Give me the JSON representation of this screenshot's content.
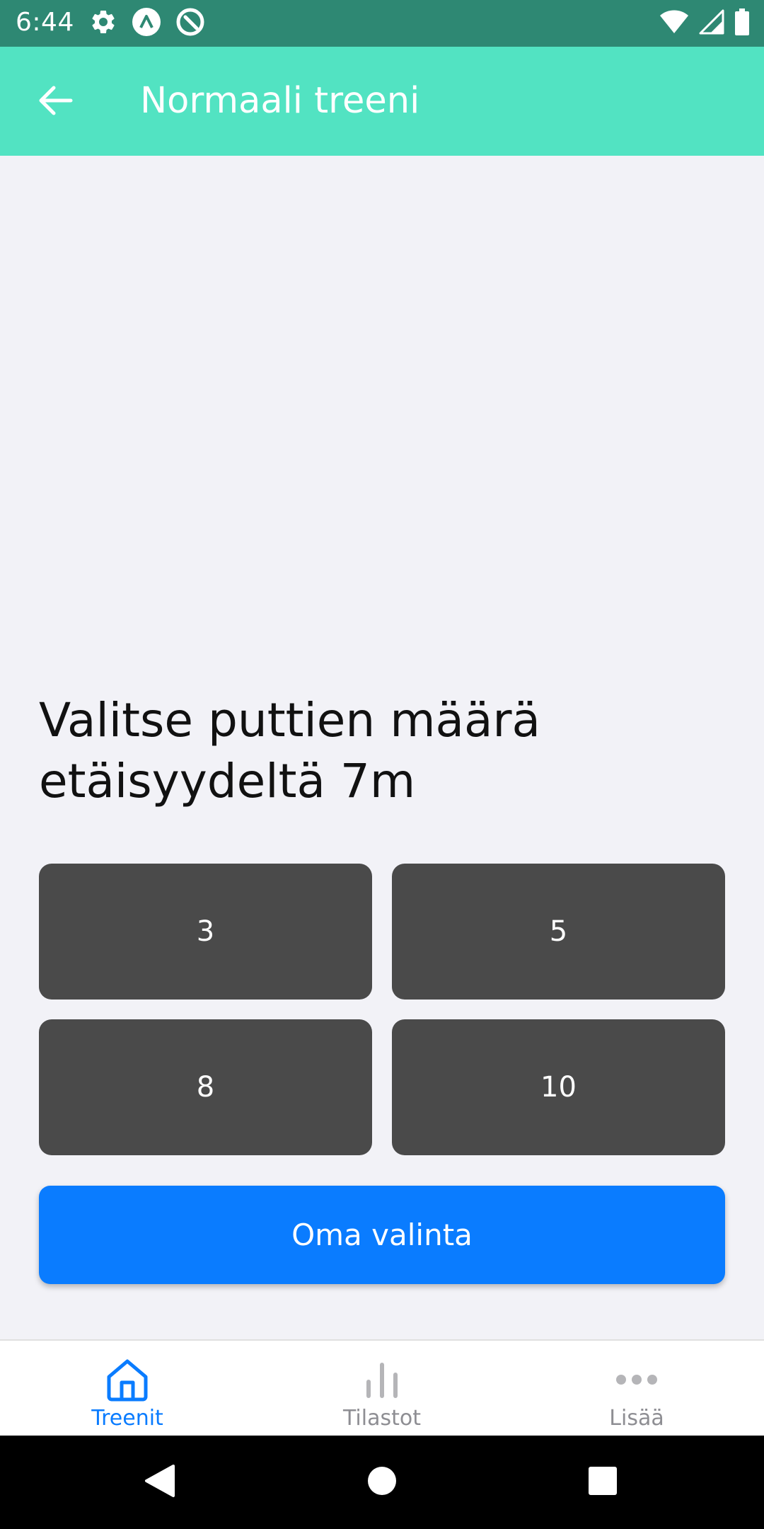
{
  "status_bar": {
    "time": "6:44",
    "left_icons": [
      "gear-icon",
      "app-a-icon",
      "app-q-icon"
    ],
    "right_icons": [
      "wifi-icon",
      "signal-icon",
      "battery-icon"
    ],
    "background": "#2e8873"
  },
  "app_bar": {
    "title": "Normaali treeni",
    "back_icon": "arrow-left-icon",
    "background": "#52e3c2"
  },
  "main": {
    "prompt": "Valitse puttien määrä etäisyydeltä 7m",
    "choices": [
      "3",
      "5",
      "8",
      "10"
    ],
    "choice_color": "#4a4a4a",
    "custom_label": "Oma valinta",
    "custom_color": "#0a7cff"
  },
  "tab_bar": {
    "tabs": [
      {
        "label": "Treenit",
        "icon": "home-icon",
        "active": true
      },
      {
        "label": "Tilastot",
        "icon": "bar-chart-icon",
        "active": false
      },
      {
        "label": "Lisää",
        "icon": "more-dots-icon",
        "active": false
      }
    ],
    "active_color": "#0a7cff",
    "inactive_color": "#8e8e93"
  },
  "nav_bar": {
    "buttons": [
      "back-triangle-icon",
      "home-circle-icon",
      "recents-square-icon"
    ]
  }
}
